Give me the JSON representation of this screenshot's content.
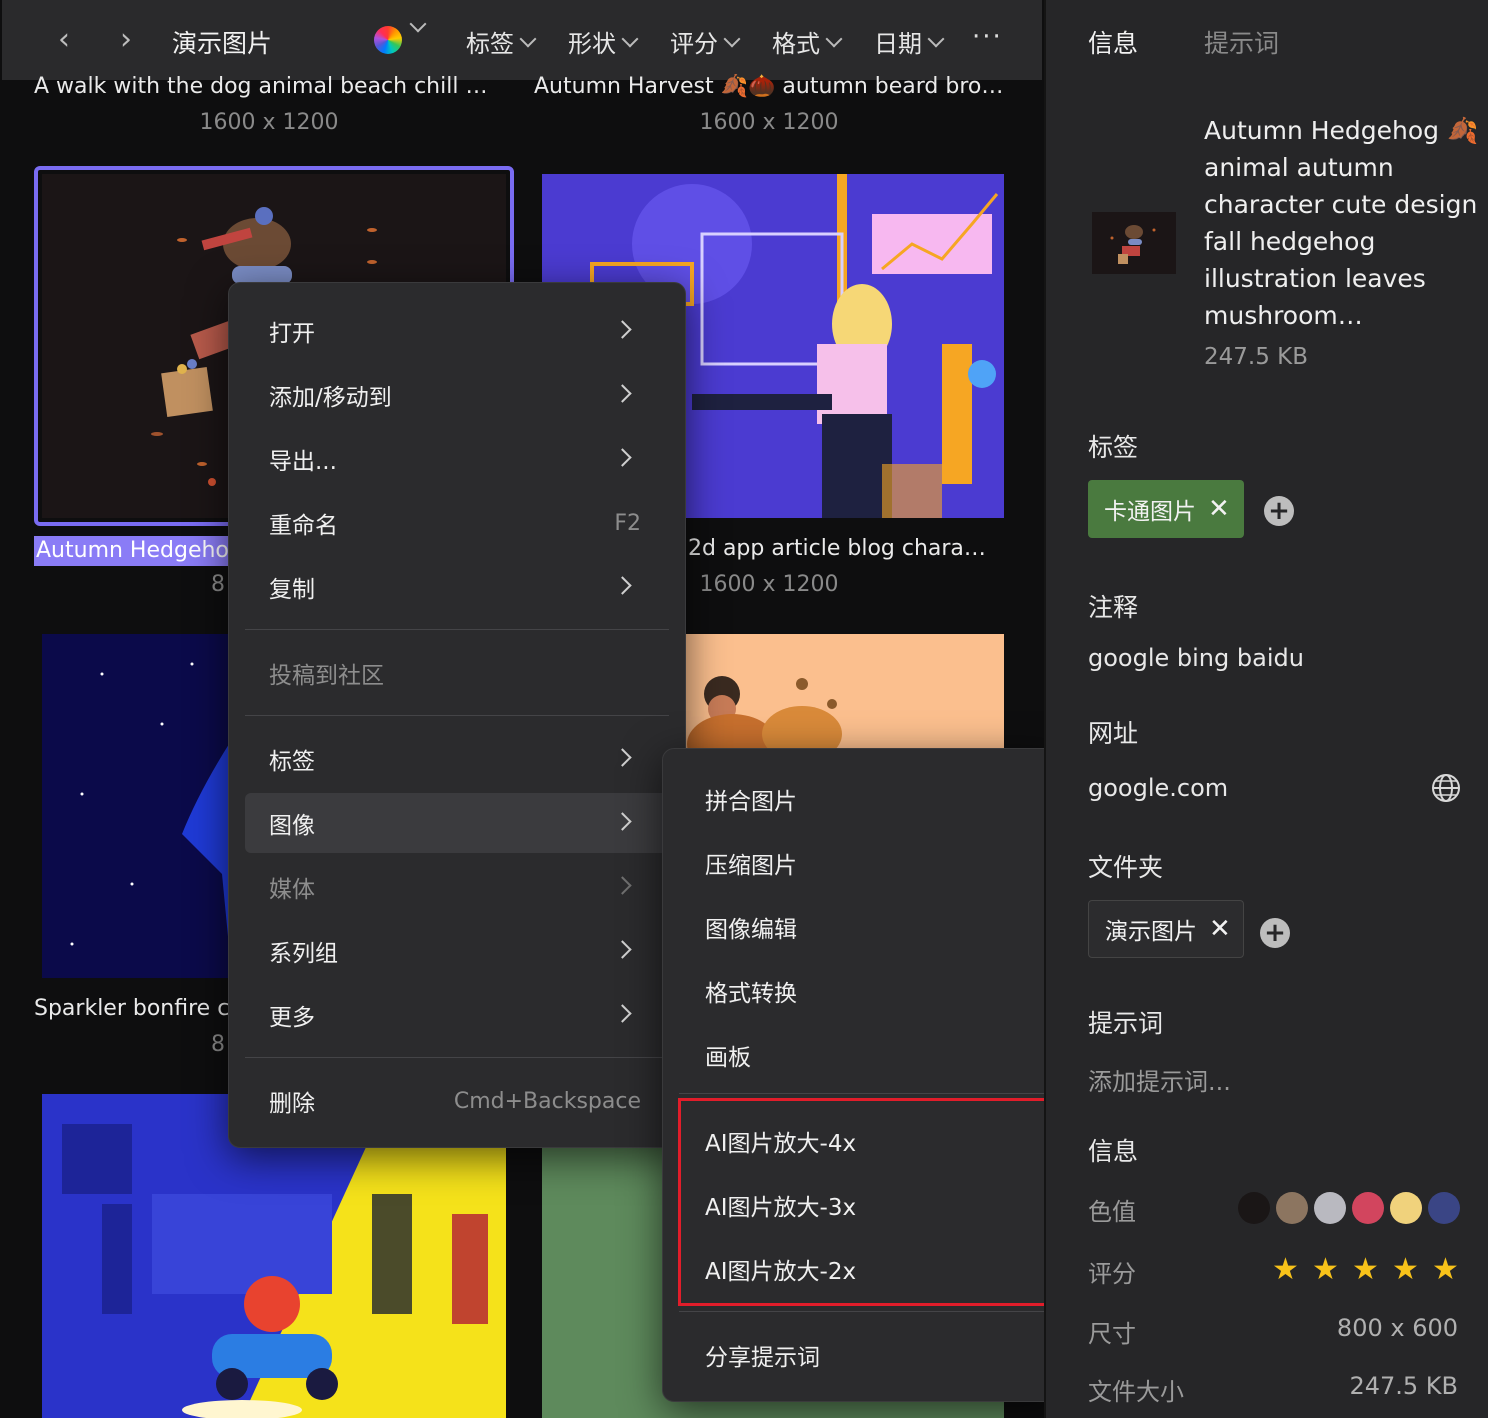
{
  "toolbar": {
    "folder_title": "演示图片",
    "filters": [
      "标签",
      "形状",
      "评分",
      "格式",
      "日期"
    ],
    "more": "···"
  },
  "gallery": {
    "top_items": [
      {
        "caption": "A walk with the dog animal beach chill …",
        "dims": "1600 x 1200"
      },
      {
        "caption": "Autumn Harvest 🍂🌰 autumn beard bro…",
        "dims": "1600 x 1200"
      }
    ],
    "selected_caption": "Autumn Hedgeho",
    "selected_dims_partial": "8",
    "app_caption": "2d app article blog chara…",
    "app_dims": "1600 x 1200",
    "sparkler_caption": "Sparkler bonfire c",
    "sparkler_dims_partial": "8"
  },
  "context_menu": {
    "items": [
      {
        "label": "打开",
        "submenu": true
      },
      {
        "label": "添加/移动到",
        "submenu": true
      },
      {
        "label": "导出...",
        "submenu": true
      },
      {
        "label": "重命名",
        "shortcut": "F2"
      },
      {
        "label": "复制",
        "submenu": true
      },
      {
        "label": "投稿到社区",
        "disabled": true
      },
      {
        "label": "标签",
        "submenu": true
      },
      {
        "label": "图像",
        "submenu": true,
        "active": true
      },
      {
        "label": "媒体",
        "submenu": true,
        "disabled": true
      },
      {
        "label": "系列组",
        "submenu": true
      },
      {
        "label": "更多",
        "submenu": true
      },
      {
        "label": "删除",
        "shortcut": "Cmd+Backspace"
      }
    ]
  },
  "image_submenu": {
    "items": [
      "拼合图片",
      "压缩图片",
      "图像编辑",
      "格式转换",
      "画板"
    ],
    "ai_items": [
      "AI图片放大-4x",
      "AI图片放大-3x",
      "AI图片放大-2x"
    ],
    "share": "分享提示词"
  },
  "panel": {
    "tabs": [
      "信息",
      "提示词"
    ],
    "title": "Autumn Hedgehog 🍂 animal autumn character cute design fall hedgehog illustration leaves mushroom…",
    "file_size": "247.5 KB",
    "tags_label": "标签",
    "tag": "卡通图片",
    "notes_label": "注释",
    "notes": "google bing baidu",
    "url_label": "网址",
    "url": "google.com",
    "folder_label": "文件夹",
    "folder": "演示图片",
    "prompt_label": "提示词",
    "prompt_placeholder": "添加提示词...",
    "info_label": "信息",
    "color_label": "色值",
    "colors": [
      "#1a1616",
      "#8c7560",
      "#b9b9c0",
      "#d2455e",
      "#f0d27c",
      "#3a4585"
    ],
    "rating_label": "评分",
    "rating": 5,
    "dimensions_label": "尺寸",
    "dimensions": "800 x 600",
    "filesize_label": "文件大小",
    "filesize": "247.5 KB",
    "remove_glyph": "✕",
    "add_glyph": "+"
  }
}
